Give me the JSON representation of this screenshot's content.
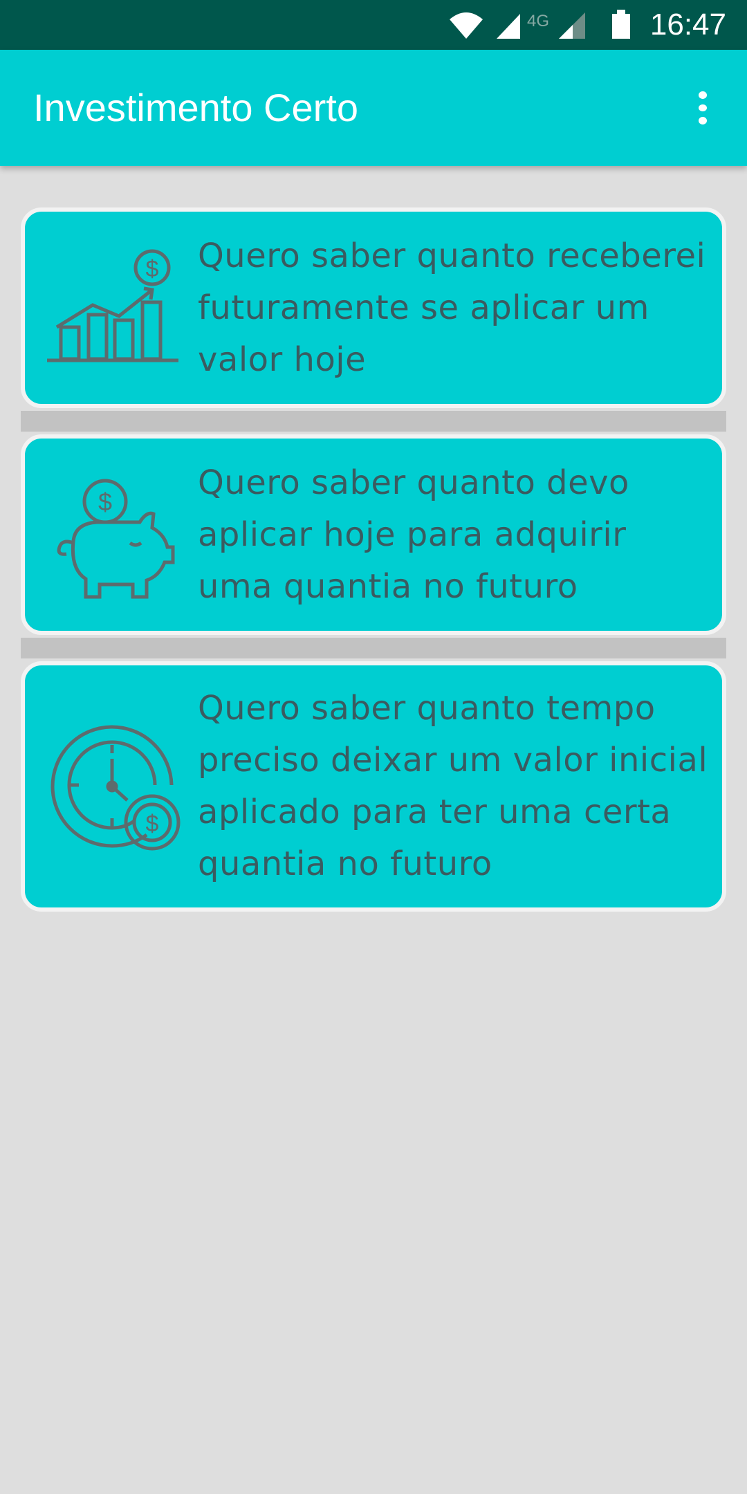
{
  "status_bar": {
    "time": "16:47",
    "network_label": "4G",
    "icons": [
      "wifi-icon",
      "signal-icon",
      "signal-4g-icon",
      "battery-icon"
    ]
  },
  "app_bar": {
    "title": "Investimento Certo",
    "menu_icon": "more-vert-icon"
  },
  "cards": [
    {
      "icon": "growth-chart-dollar-icon",
      "text": "Quero saber quanto receberei futuramente se aplicar um valor hoje"
    },
    {
      "icon": "piggy-bank-dollar-icon",
      "text": "Quero saber quanto devo aplicar hoje para adquirir uma quantia no futuro"
    },
    {
      "icon": "clock-dollar-icon",
      "text": "Quero saber quanto tempo preciso deixar um valor inicial aplicado para ter uma certa quantia no futuro"
    }
  ],
  "colors": {
    "status_bar": "#00574c",
    "app_bar": "#00ced1",
    "card_background": "#00ced1",
    "card_text": "#3a5b60",
    "icon_stroke": "#5d6b6d",
    "page_background": "#dedede",
    "separator": "#c2c2c2"
  }
}
